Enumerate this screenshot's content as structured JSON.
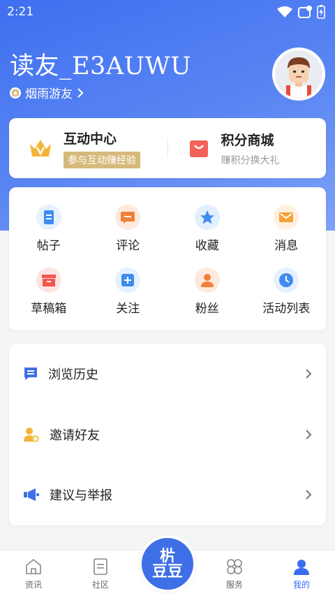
{
  "status": {
    "time": "2:21"
  },
  "profile": {
    "username": "读友_E3AUWU",
    "level": "烟雨游友"
  },
  "top_card": {
    "interact": {
      "title": "互动中心",
      "subtitle": "参与互动赚经验"
    },
    "mall": {
      "title": "积分商城",
      "subtitle": "赚积分换大礼"
    }
  },
  "grid": [
    {
      "label": "帖子",
      "icon": "post-icon",
      "color": "#3f8cf0",
      "bg": "#e5f1fd"
    },
    {
      "label": "评论",
      "icon": "comment-icon",
      "color": "#f07f3a",
      "bg": "#fde9de"
    },
    {
      "label": "收藏",
      "icon": "star-icon",
      "color": "#3f8cf0",
      "bg": "#e2effd"
    },
    {
      "label": "消息",
      "icon": "mail-icon",
      "color": "#f6a13b",
      "bg": "#fef0de"
    },
    {
      "label": "草稿箱",
      "icon": "drafts-icon",
      "color": "#f2554d",
      "bg": "#fde4e2"
    },
    {
      "label": "关注",
      "icon": "follow-icon",
      "color": "#3f8cf0",
      "bg": "#e5f1fd"
    },
    {
      "label": "粉丝",
      "icon": "fans-icon",
      "color": "#f07f3a",
      "bg": "#fde9de"
    },
    {
      "label": "活动列表",
      "icon": "clock-icon",
      "color": "#3f8cf0",
      "bg": "#e5f1fd"
    }
  ],
  "list": [
    {
      "label": "浏览历史",
      "icon": "history-icon"
    },
    {
      "label": "邀请好友",
      "icon": "invite-icon"
    },
    {
      "label": "建议与举报",
      "icon": "report-icon"
    }
  ],
  "tabs": [
    {
      "label": "资讯",
      "icon": "news-icon"
    },
    {
      "label": "社区",
      "icon": "community-icon"
    },
    {
      "label": "服务",
      "icon": "service-icon"
    },
    {
      "label": "我的",
      "icon": "mine-icon"
    }
  ],
  "center_logo": {
    "line1": "㭊",
    "line2": "豆豆"
  }
}
